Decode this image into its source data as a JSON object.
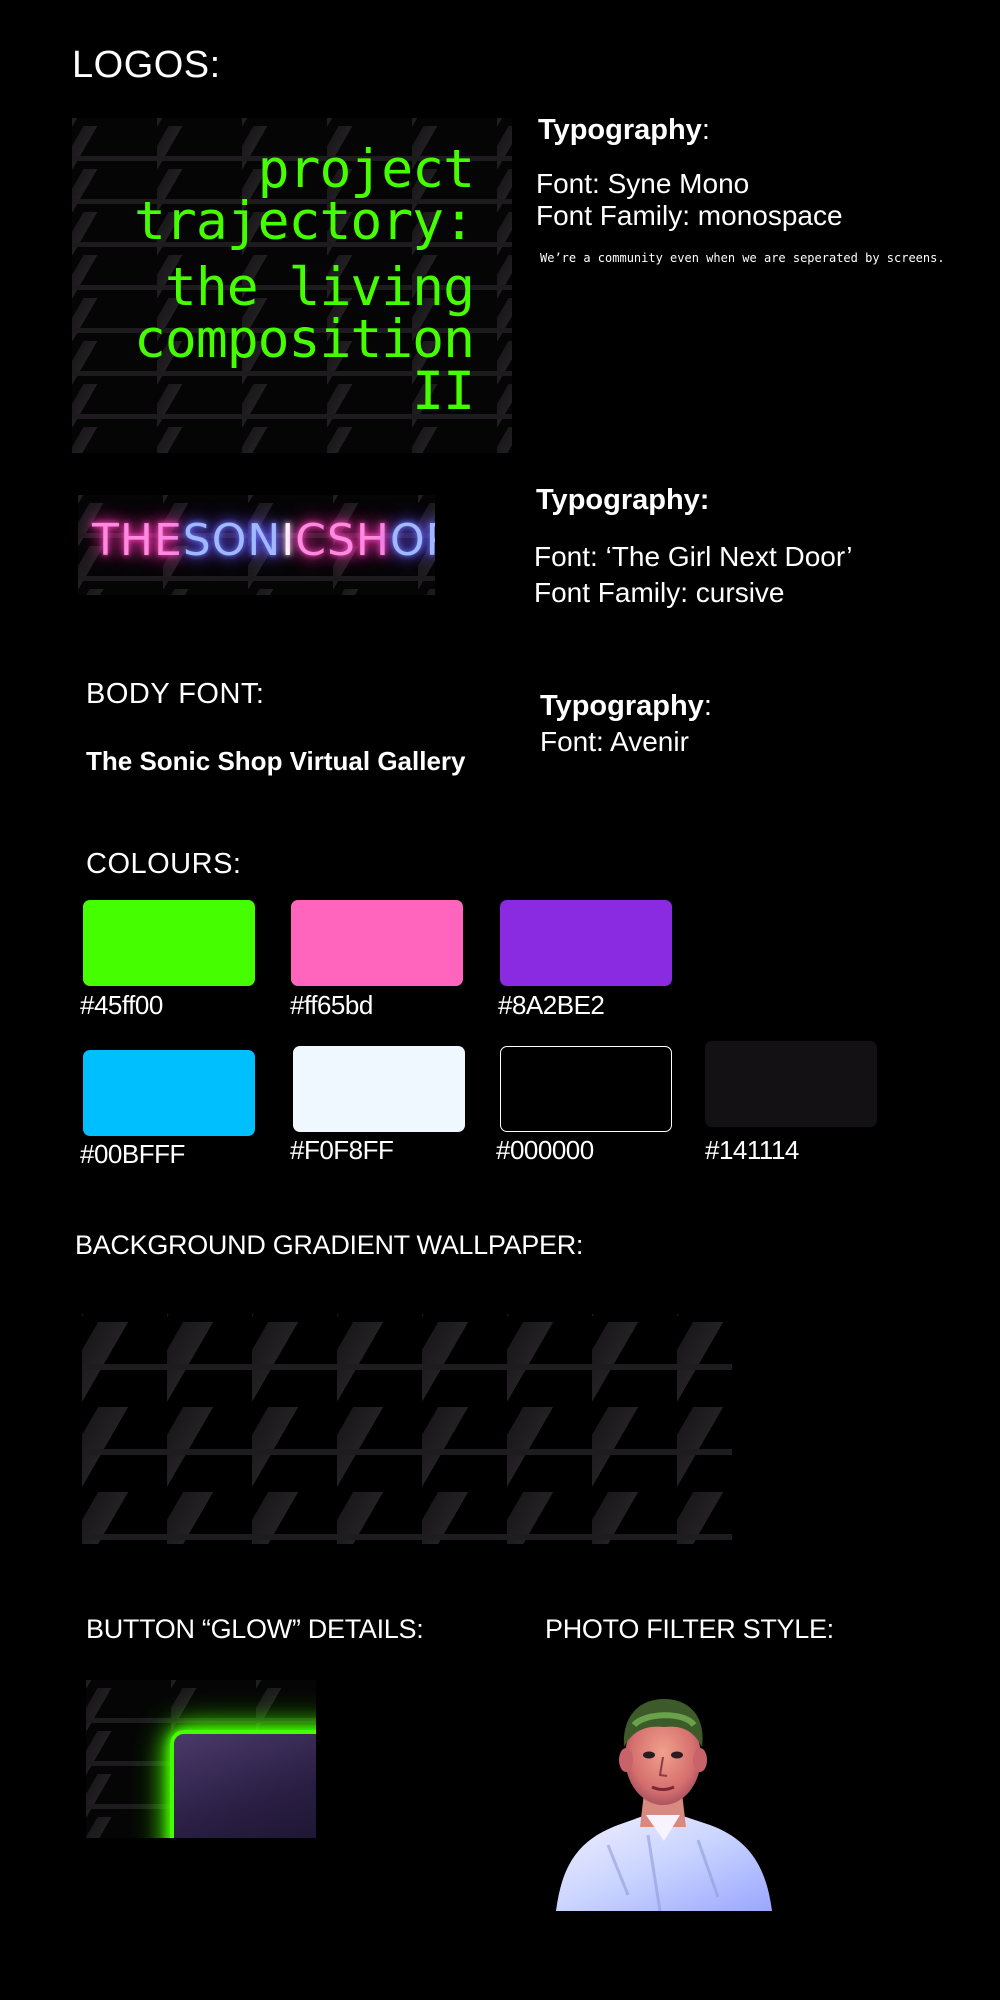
{
  "logos": {
    "heading": "LOGOS:",
    "logo1_lines_top": [
      "project",
      "trajectory:"
    ],
    "logo1_lines_bottom": [
      "the living",
      "composition",
      "II"
    ],
    "logo2_parts": [
      {
        "text": "THE",
        "tone": "pink"
      },
      {
        "text": "SON",
        "tone": "blue"
      },
      {
        "text": "I",
        "tone": "white"
      },
      {
        "text": "C",
        "tone": "pink"
      },
      {
        "text": "SH",
        "tone": "pink"
      },
      {
        "text": "OP",
        "tone": "blue"
      }
    ]
  },
  "typography_1": {
    "title": "Typography",
    "colon": ":",
    "font": "Font: Syne Mono",
    "family": "Font Family: monospace",
    "sample": "We’re a community even when we are seperated by screens."
  },
  "typography_2": {
    "title": "Typography:",
    "font": "Font: ‘The Girl Next Door’",
    "family": "Font Family: cursive"
  },
  "body_font": {
    "heading": "BODY FONT:",
    "sample": "The Sonic Shop Virtual Gallery"
  },
  "typography_3": {
    "title": "Typography",
    "colon": ":",
    "font": "Font: Avenir"
  },
  "colours": {
    "heading": "COLOURS:",
    "swatches": [
      {
        "hex": "#45ff00",
        "label": "#45ff00"
      },
      {
        "hex": "#ff65bd",
        "label": "#ff65bd"
      },
      {
        "hex": "#8A2BE2",
        "label": "#8A2BE2"
      },
      {
        "hex": "#00BFFF",
        "label": "#00BFFF"
      },
      {
        "hex": "#F0F8FF",
        "label": "#F0F8FF"
      },
      {
        "hex": "#000000",
        "label": "#000000"
      },
      {
        "hex": "#141114",
        "label": "#141114"
      }
    ]
  },
  "wallpaper": {
    "heading": "BACKGROUND GRADIENT WALLPAPER:"
  },
  "glow": {
    "heading": "BUTTON “GLOW” DETAILS:",
    "glow_color": "#45ff00"
  },
  "photo": {
    "heading": "PHOTO FILTER STYLE:"
  }
}
